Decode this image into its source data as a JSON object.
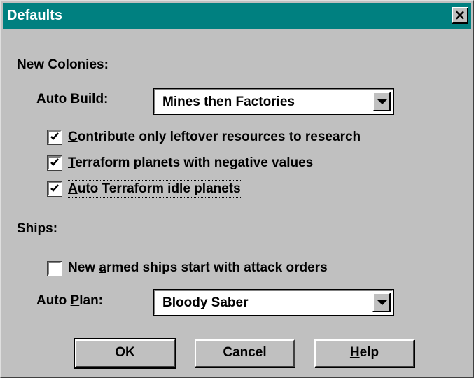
{
  "window": {
    "title": "Defaults"
  },
  "new_colonies": {
    "heading": "New Colonies:",
    "auto_build": {
      "label_pre": "Auto ",
      "label_mnemonic": "B",
      "label_post": "uild:",
      "selected": "Mines then Factories"
    },
    "checkboxes": [
      {
        "mnemonic": "C",
        "rest": "ontribute only leftover resources to research",
        "checked": true
      },
      {
        "mnemonic": "T",
        "rest": "erraform planets with negative values",
        "checked": true
      },
      {
        "mnemonic": "A",
        "rest": "uto Terraform idle planets",
        "checked": true
      }
    ]
  },
  "ships": {
    "heading": "Ships:",
    "armed_orders": {
      "pre": "New ",
      "mnemonic": "a",
      "rest": "rmed ships start with attack orders",
      "checked": false
    },
    "auto_plan": {
      "label_pre": "Auto ",
      "label_mnemonic": "P",
      "label_post": "lan:",
      "selected": "Bloody Saber"
    }
  },
  "buttons": {
    "ok": "OK",
    "cancel": "Cancel",
    "help_mnemonic": "H",
    "help_rest": "elp"
  },
  "colors": {
    "titlebar": "#008080",
    "face": "#c0c0c0"
  }
}
